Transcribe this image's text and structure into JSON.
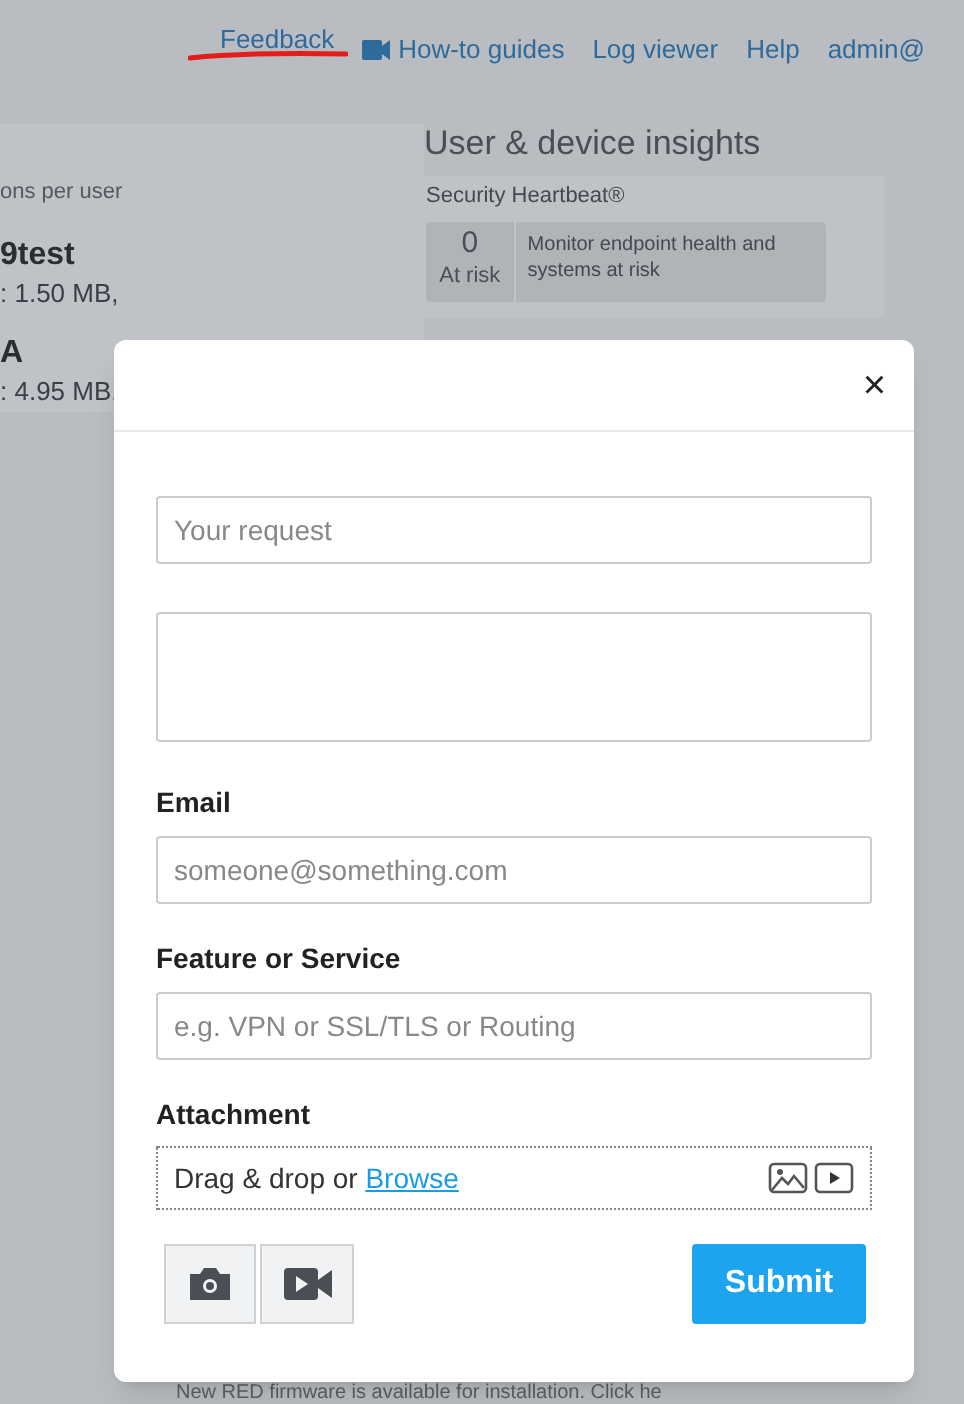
{
  "top_nav": [
    {
      "label": "Feedback",
      "kind": "link",
      "annotated": true
    },
    {
      "label": "How-to guides",
      "kind": "video",
      "annotated": false
    },
    {
      "label": "Log viewer",
      "kind": "link",
      "annotated": false
    },
    {
      "label": "Help",
      "kind": "link",
      "annotated": false
    },
    {
      "label": "admin@",
      "kind": "link",
      "annotated": false
    }
  ],
  "left_panel": {
    "caption": "ons per user",
    "users": [
      {
        "name": "9test",
        "detail": ": 1.50 MB,"
      },
      {
        "name": "A",
        "detail": ": 4.95 MB,"
      }
    ]
  },
  "insights": {
    "title": "User & device insights",
    "heartbeat_title": "Security Heartbeat®",
    "count": "0",
    "count_label": "At risk",
    "description": "Monitor endpoint health and systems at risk"
  },
  "notice": "New RED firmware is available for installation. Click he",
  "dialog": {
    "close": "×",
    "request": {
      "placeholder": "Your request"
    },
    "email": {
      "label": "Email",
      "placeholder": "someone@something.com"
    },
    "feature": {
      "label": "Feature or Service",
      "placeholder": "e.g. VPN or SSL/TLS or Routing"
    },
    "attachment": {
      "label": "Attachment",
      "text": "Drag & drop or ",
      "link": "Browse"
    },
    "submit": "Submit"
  }
}
